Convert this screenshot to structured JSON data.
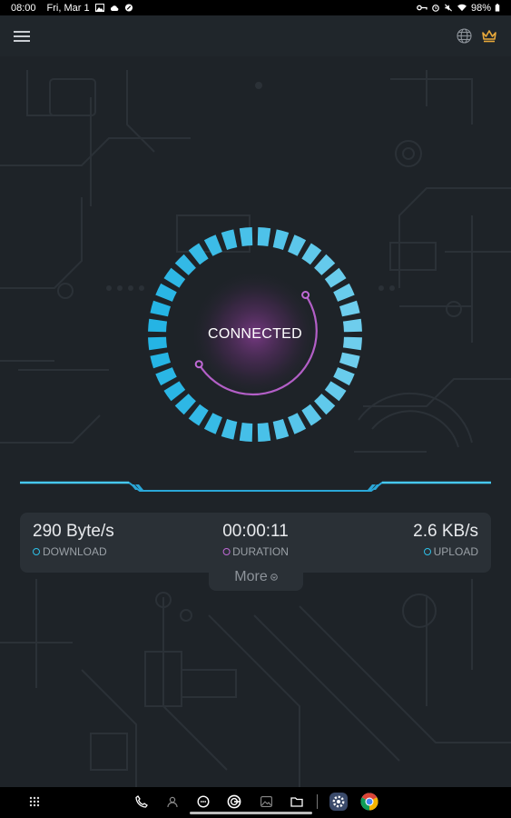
{
  "status_bar": {
    "time": "08:00",
    "date": "Fri, Mar 1",
    "battery": "98%"
  },
  "app_bar": {
    "menu_icon": "hamburger-menu-icon",
    "globe_icon": "globe-icon",
    "premium_icon": "crown-icon"
  },
  "connection": {
    "status": "CONNECTED"
  },
  "stats": {
    "download": {
      "value": "290 Byte/s",
      "label": "DOWNLOAD"
    },
    "duration": {
      "value": "00:00:11",
      "label": "DURATION"
    },
    "upload": {
      "value": "2.6 KB/s",
      "label": "UPLOAD"
    }
  },
  "more": {
    "label": "More"
  },
  "colors": {
    "accent_cyan": "#2ec0e8",
    "accent_purple": "#c06ad6",
    "background": "#1e2328"
  },
  "nav_bar": {
    "icons": [
      "apps-grid-icon",
      "phone-icon",
      "contacts-icon",
      "messages-icon",
      "gboard-icon",
      "gallery-icon",
      "files-icon",
      "settings-icon",
      "chrome-icon"
    ]
  }
}
